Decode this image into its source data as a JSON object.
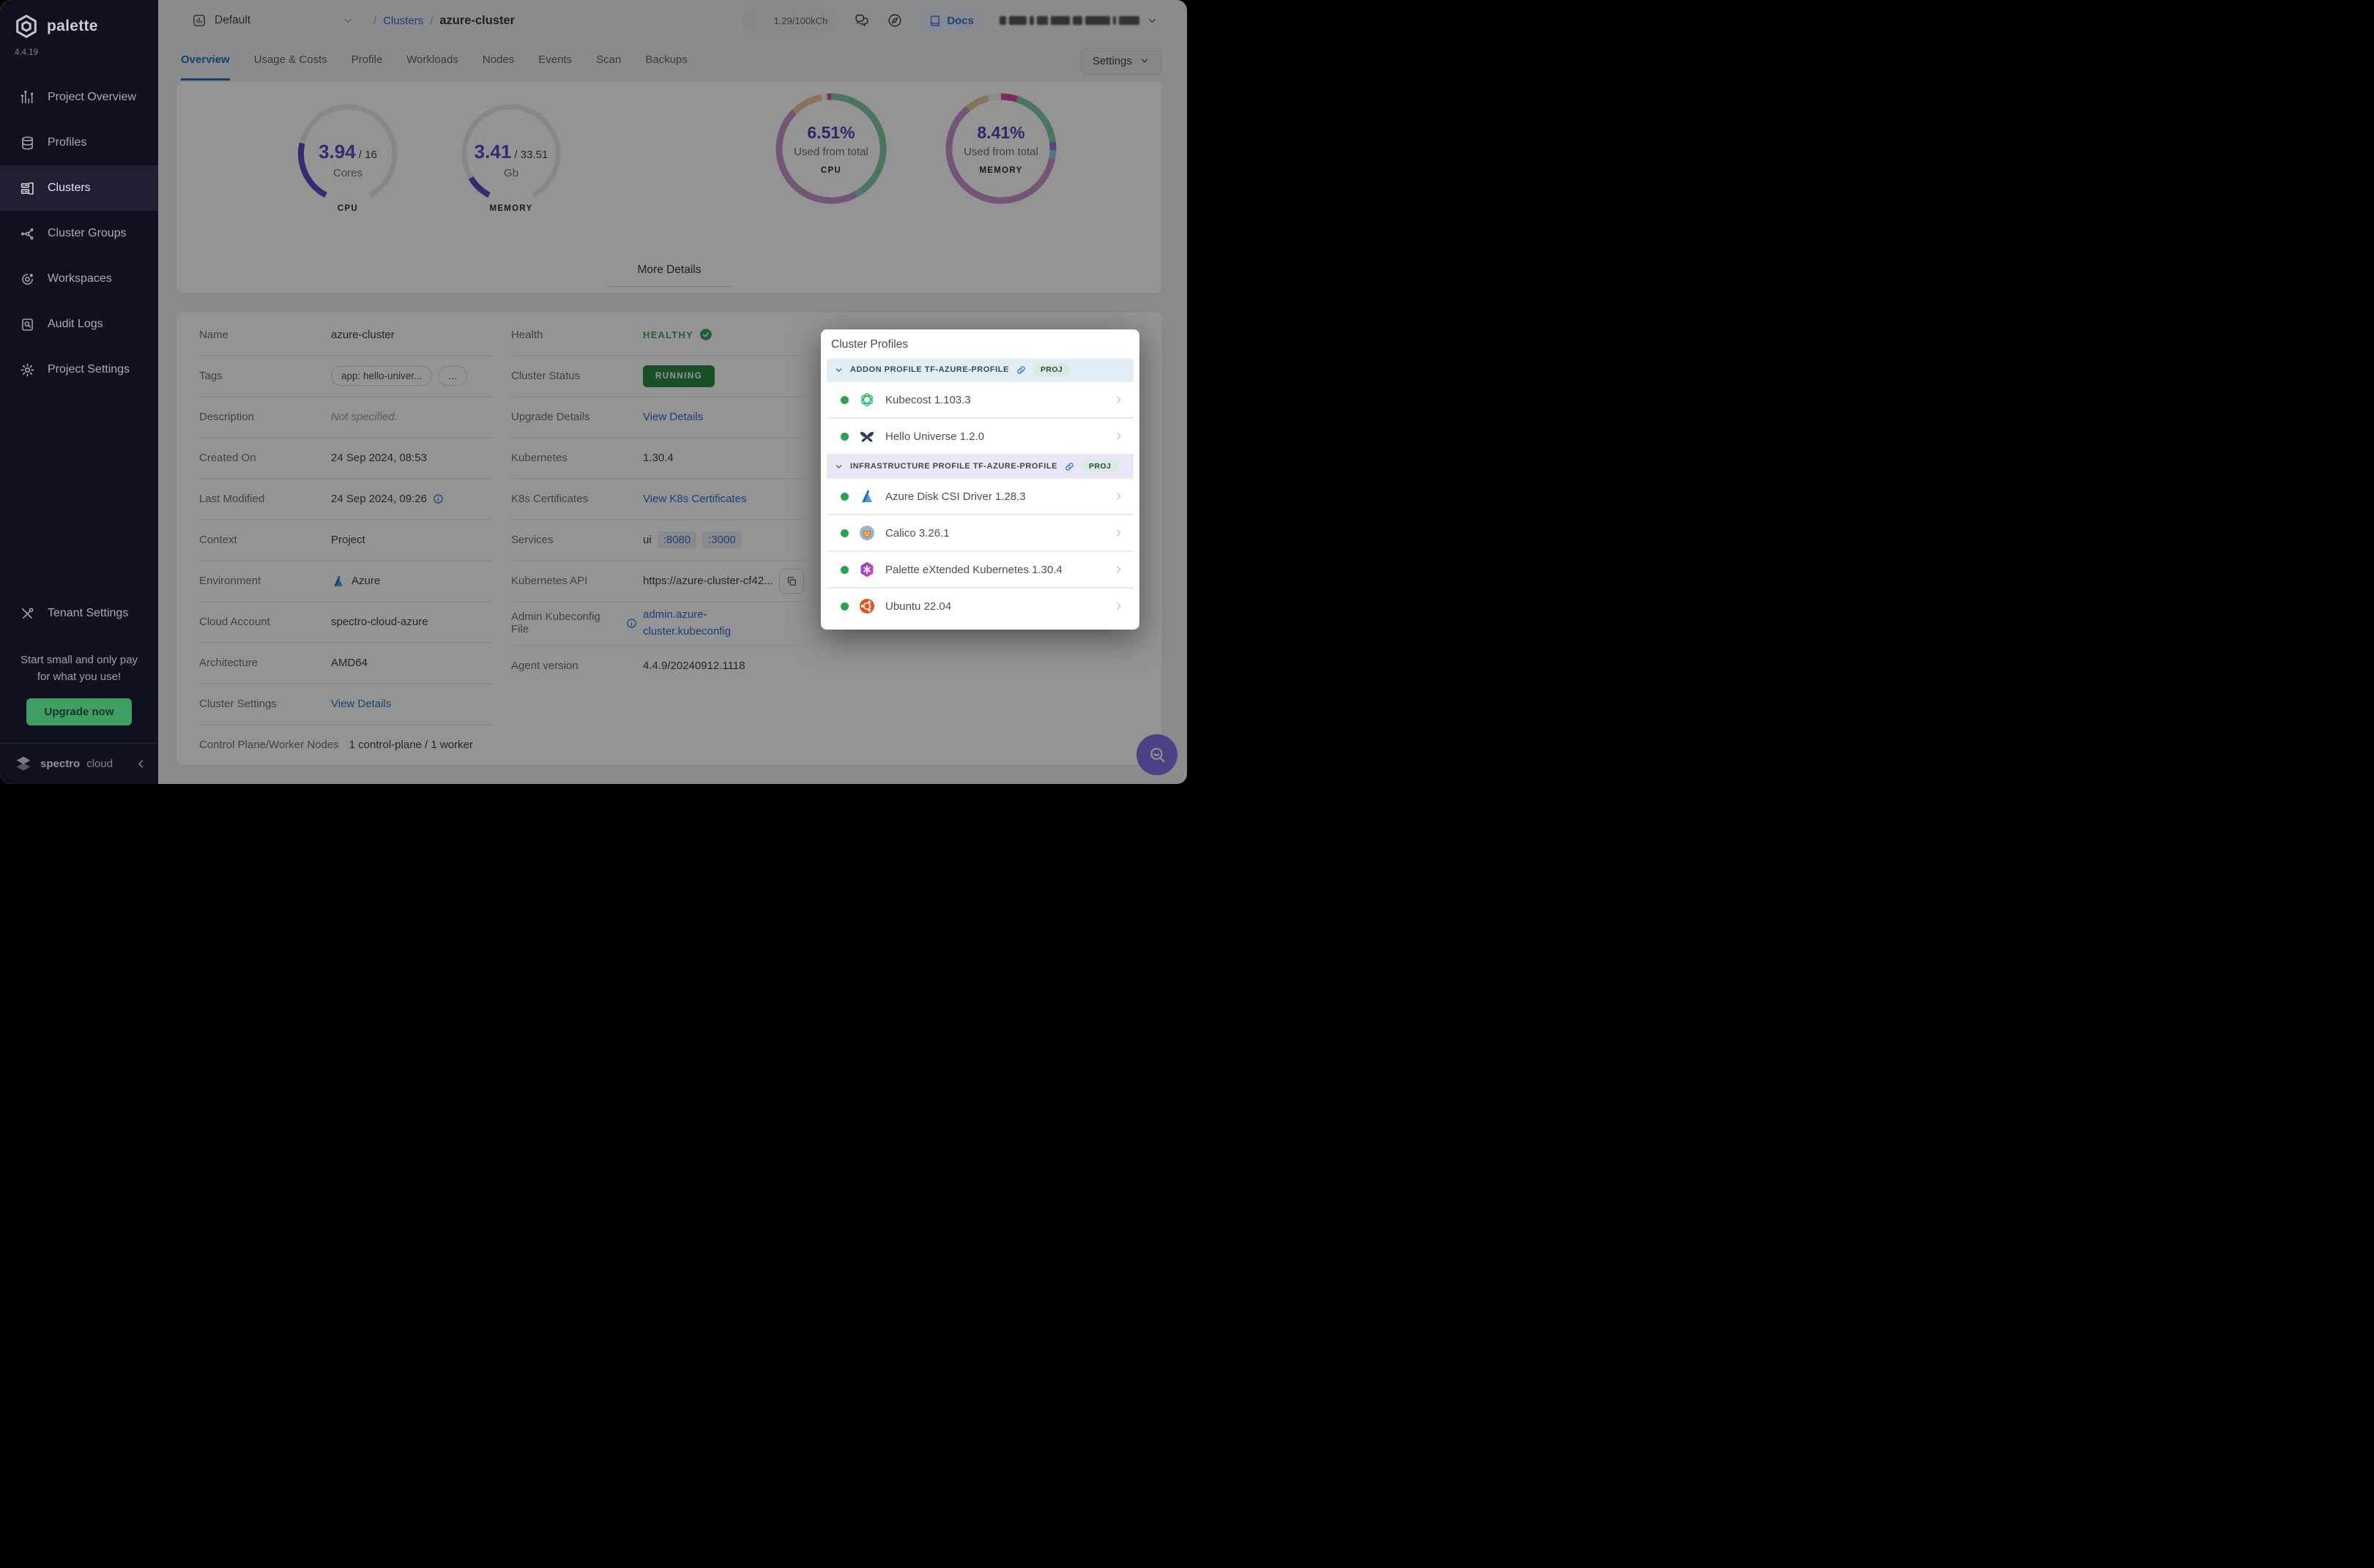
{
  "sidebar": {
    "logo_text": "palette",
    "version": "4.4.19",
    "items": [
      {
        "label": "Project Overview",
        "icon": "chart-icon",
        "active": false
      },
      {
        "label": "Profiles",
        "icon": "layers-icon",
        "active": false
      },
      {
        "label": "Clusters",
        "icon": "clusters-icon",
        "active": true
      },
      {
        "label": "Cluster Groups",
        "icon": "groups-icon",
        "active": false
      },
      {
        "label": "Workspaces",
        "icon": "workspaces-icon",
        "active": false
      },
      {
        "label": "Audit Logs",
        "icon": "audit-icon",
        "active": false
      },
      {
        "label": "Project Settings",
        "icon": "gear-icon",
        "active": false
      }
    ],
    "tenant": {
      "label": "Tenant Settings",
      "icon": "tools-icon"
    },
    "promo": {
      "line1": "Start small and only pay",
      "line2": "for what you use!",
      "button": "Upgrade now"
    },
    "footer": {
      "brand_bold": "spectro",
      "brand_light": "cloud"
    }
  },
  "topbar": {
    "project_selector": "Default",
    "breadcrumb": {
      "separator": "/",
      "parent": "Clusters",
      "current": "azure-cluster"
    },
    "credits": "1.29/100kCh",
    "docs_label": "Docs"
  },
  "tabs": {
    "items": [
      "Overview",
      "Usage & Costs",
      "Profile",
      "Workloads",
      "Nodes",
      "Events",
      "Scan",
      "Backups"
    ],
    "active_index": 0,
    "settings_label": "Settings"
  },
  "overview": {
    "more_details_label": "More Details"
  },
  "chart_data": [
    {
      "type": "gauge",
      "title": "CPU",
      "value": 3.94,
      "max": 16,
      "value_label": "3.94",
      "max_label": " / 16",
      "unit": "Cores",
      "color": "#564fc3",
      "track_color": "#e7e9ee"
    },
    {
      "type": "gauge",
      "title": "MEMORY",
      "value": 3.41,
      "max": 33.51,
      "value_label": "3.41",
      "max_label": " / 33.51",
      "unit": "Gb",
      "color": "#564fc3",
      "track_color": "#e7e9ee"
    },
    {
      "type": "donut",
      "title": "CPU",
      "center_value": "6.51%",
      "center_label": "Used from total",
      "segments": [
        {
          "label": "segment-green",
          "value": 40,
          "color": "#84c9a3"
        },
        {
          "label": "segment-blue",
          "value": 2,
          "color": "#8ec9e8"
        },
        {
          "label": "segment-rose",
          "value": 45.5,
          "color": "#c795c9"
        },
        {
          "label": "segment-tan",
          "value": 9.5,
          "color": "#e7c9a1"
        },
        {
          "label": "segment-white",
          "value": 1.8,
          "color": "#f1f2f4"
        },
        {
          "label": "segment-magenta",
          "value": 1.2,
          "color": "#cf4f9d"
        }
      ]
    },
    {
      "type": "donut",
      "title": "MEMORY",
      "center_value": "8.41%",
      "center_label": "Used from total",
      "segments": [
        {
          "label": "segment-magenta",
          "value": 5,
          "color": "#cf4f9d"
        },
        {
          "label": "segment-green",
          "value": 18,
          "color": "#84c9a3"
        },
        {
          "label": "segment-purple",
          "value": 2.5,
          "color": "#8a7ad2"
        },
        {
          "label": "segment-blue",
          "value": 2.5,
          "color": "#8ec9e8"
        },
        {
          "label": "segment-rose",
          "value": 61,
          "color": "#c795c9"
        },
        {
          "label": "segment-tan",
          "value": 7,
          "color": "#e7c9a1"
        },
        {
          "label": "segment-white",
          "value": 4,
          "color": "#f1f2f4"
        }
      ]
    }
  ],
  "details": {
    "left_rows": [
      {
        "label": "Name",
        "type": "text",
        "value": "azure-cluster"
      },
      {
        "label": "Tags",
        "type": "tags",
        "chips": [
          "app: hello-univer...",
          "..."
        ]
      },
      {
        "label": "Description",
        "type": "muted",
        "value": "Not specified."
      },
      {
        "label": "Created On",
        "type": "text",
        "value": "24 Sep 2024, 08:53"
      },
      {
        "label": "Last Modified",
        "type": "text",
        "value": "24 Sep 2024, 09:26",
        "value_info": true
      },
      {
        "label": "Context",
        "type": "text",
        "value": "Project"
      },
      {
        "label": "Environment",
        "type": "env",
        "value": "Azure"
      },
      {
        "label": "Cloud Account",
        "type": "text",
        "value": "spectro-cloud-azure"
      },
      {
        "label": "Architecture",
        "type": "text",
        "value": "AMD64"
      },
      {
        "label": "Cluster Settings",
        "type": "link",
        "value": "View Details"
      },
      {
        "label": "Control Plane/Worker Nodes",
        "type": "text",
        "value": "1 control-plane / 1 worker",
        "wide": true
      }
    ],
    "right_rows": [
      {
        "label": "Health",
        "type": "health",
        "value": "HEALTHY"
      },
      {
        "label": "Cluster Status",
        "type": "status",
        "value": "RUNNING"
      },
      {
        "label": "Upgrade Details",
        "type": "link",
        "value": "View Details"
      },
      {
        "label": "Kubernetes",
        "type": "text",
        "value": "1.30.4"
      },
      {
        "label": "K8s Certificates",
        "type": "link",
        "value": "View K8s Certificates"
      },
      {
        "label": "Services",
        "type": "services",
        "prefix": "ui",
        "ports": [
          ":8080",
          ":3000"
        ]
      },
      {
        "label": "Kubernetes API",
        "type": "api",
        "value": "https://azure-cluster-cf42..."
      },
      {
        "label": "Admin Kubeconfig File",
        "type": "link",
        "value": "admin.azure-cluster.kubeconfig",
        "label_info": true,
        "wrap": true
      },
      {
        "label": "Agent version",
        "type": "text",
        "value": "4.4.9/20240912.1118"
      }
    ]
  },
  "profiles_panel": {
    "title": "Cluster Profiles",
    "groups": [
      {
        "header": "ADDON PROFILE TF-AZURE-PROFILE",
        "badge": "PROJ",
        "theme": "addon",
        "items": [
          {
            "name": "Kubecost 1.103.3",
            "logo": "kubecost-logo"
          },
          {
            "name": "Hello Universe 1.2.0",
            "logo": "hello-universe-logo"
          }
        ]
      },
      {
        "header": "INFRASTRUCTURE PROFILE TF-AZURE-PROFILE",
        "badge": "PROJ",
        "theme": "infra",
        "items": [
          {
            "name": "Azure Disk CSI Driver 1.28.3",
            "logo": "azure-logo"
          },
          {
            "name": "Calico 3.26.1",
            "logo": "calico-logo"
          },
          {
            "name": "Palette eXtended Kubernetes 1.30.4",
            "logo": "pxk-logo"
          },
          {
            "name": "Ubuntu 22.04",
            "logo": "ubuntu-logo"
          }
        ]
      }
    ]
  },
  "colors": {
    "accent_blue": "#2f6fd1",
    "indigo": "#564fc3",
    "healthy_green": "#3fa45c",
    "running_bg": "#2e8b46",
    "upgrade_green": "#3f9e63"
  }
}
